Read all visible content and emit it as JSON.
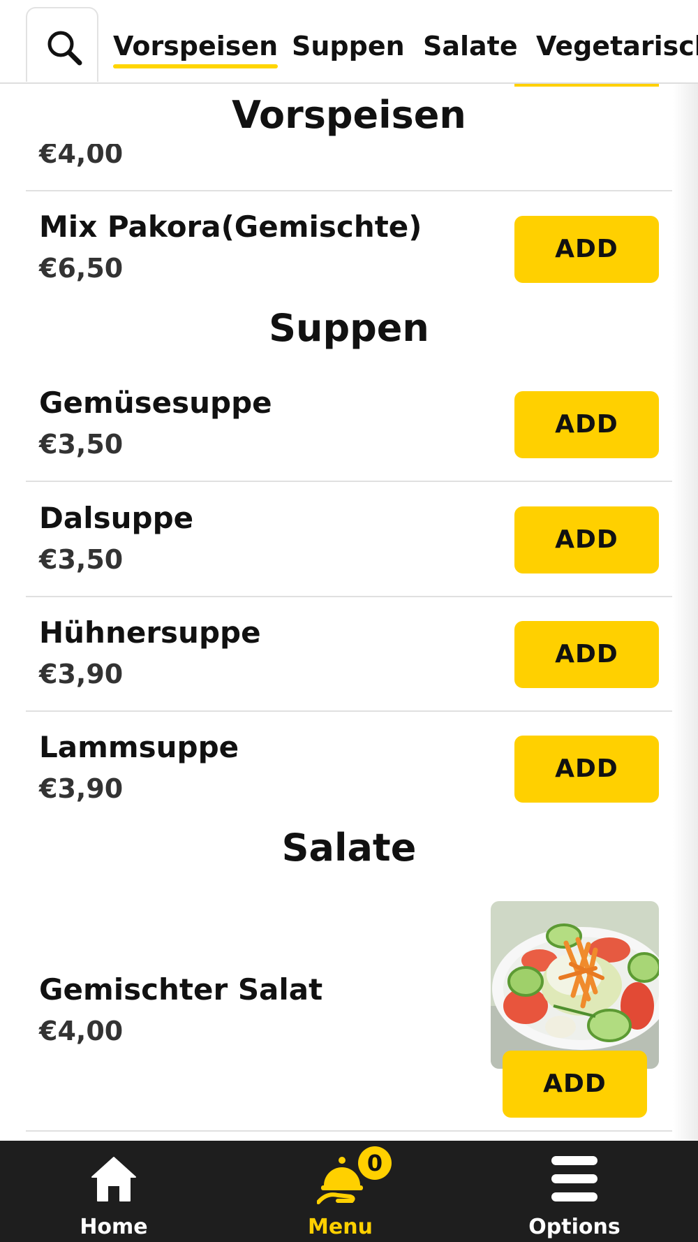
{
  "topbar": {
    "search_icon": "search-icon",
    "tabs": [
      {
        "label": "Vorspeisen",
        "active": true
      },
      {
        "label": "Suppen",
        "active": false
      },
      {
        "label": "Salate",
        "active": false
      },
      {
        "label": "Vegetarisch",
        "active": false
      }
    ]
  },
  "menu": {
    "vorspeisen": {
      "title": "Vorspeisen",
      "items": [
        {
          "price": "€4,00"
        },
        {
          "name": "Mix Pakora(Gemischte)",
          "price": "€6,50"
        }
      ]
    },
    "suppen": {
      "title": "Suppen",
      "items": [
        {
          "name": "Gemüsesuppe",
          "price": "€3,50"
        },
        {
          "name": "Dalsuppe",
          "price": "€3,50"
        },
        {
          "name": "Hühnersuppe",
          "price": "€3,90"
        },
        {
          "name": "Lammsuppe",
          "price": "€3,90"
        }
      ]
    },
    "salate": {
      "title": "Salate",
      "items": [
        {
          "name": "Gemischter Salat",
          "price": "€4,00",
          "image": "salad-photo"
        }
      ]
    },
    "add_label": "ADD"
  },
  "bottom_nav": {
    "home": {
      "label": "Home",
      "icon": "home-icon"
    },
    "menu": {
      "label": "Menu",
      "icon": "serving-cloche-icon",
      "badge": "0"
    },
    "options": {
      "label": "Options",
      "icon": "hamburger-menu-icon"
    }
  },
  "colors": {
    "accent": "#FFD000",
    "nav_background": "#1e1e1e",
    "active_nav": "#FFD000",
    "divider": "#e0e0e0"
  }
}
